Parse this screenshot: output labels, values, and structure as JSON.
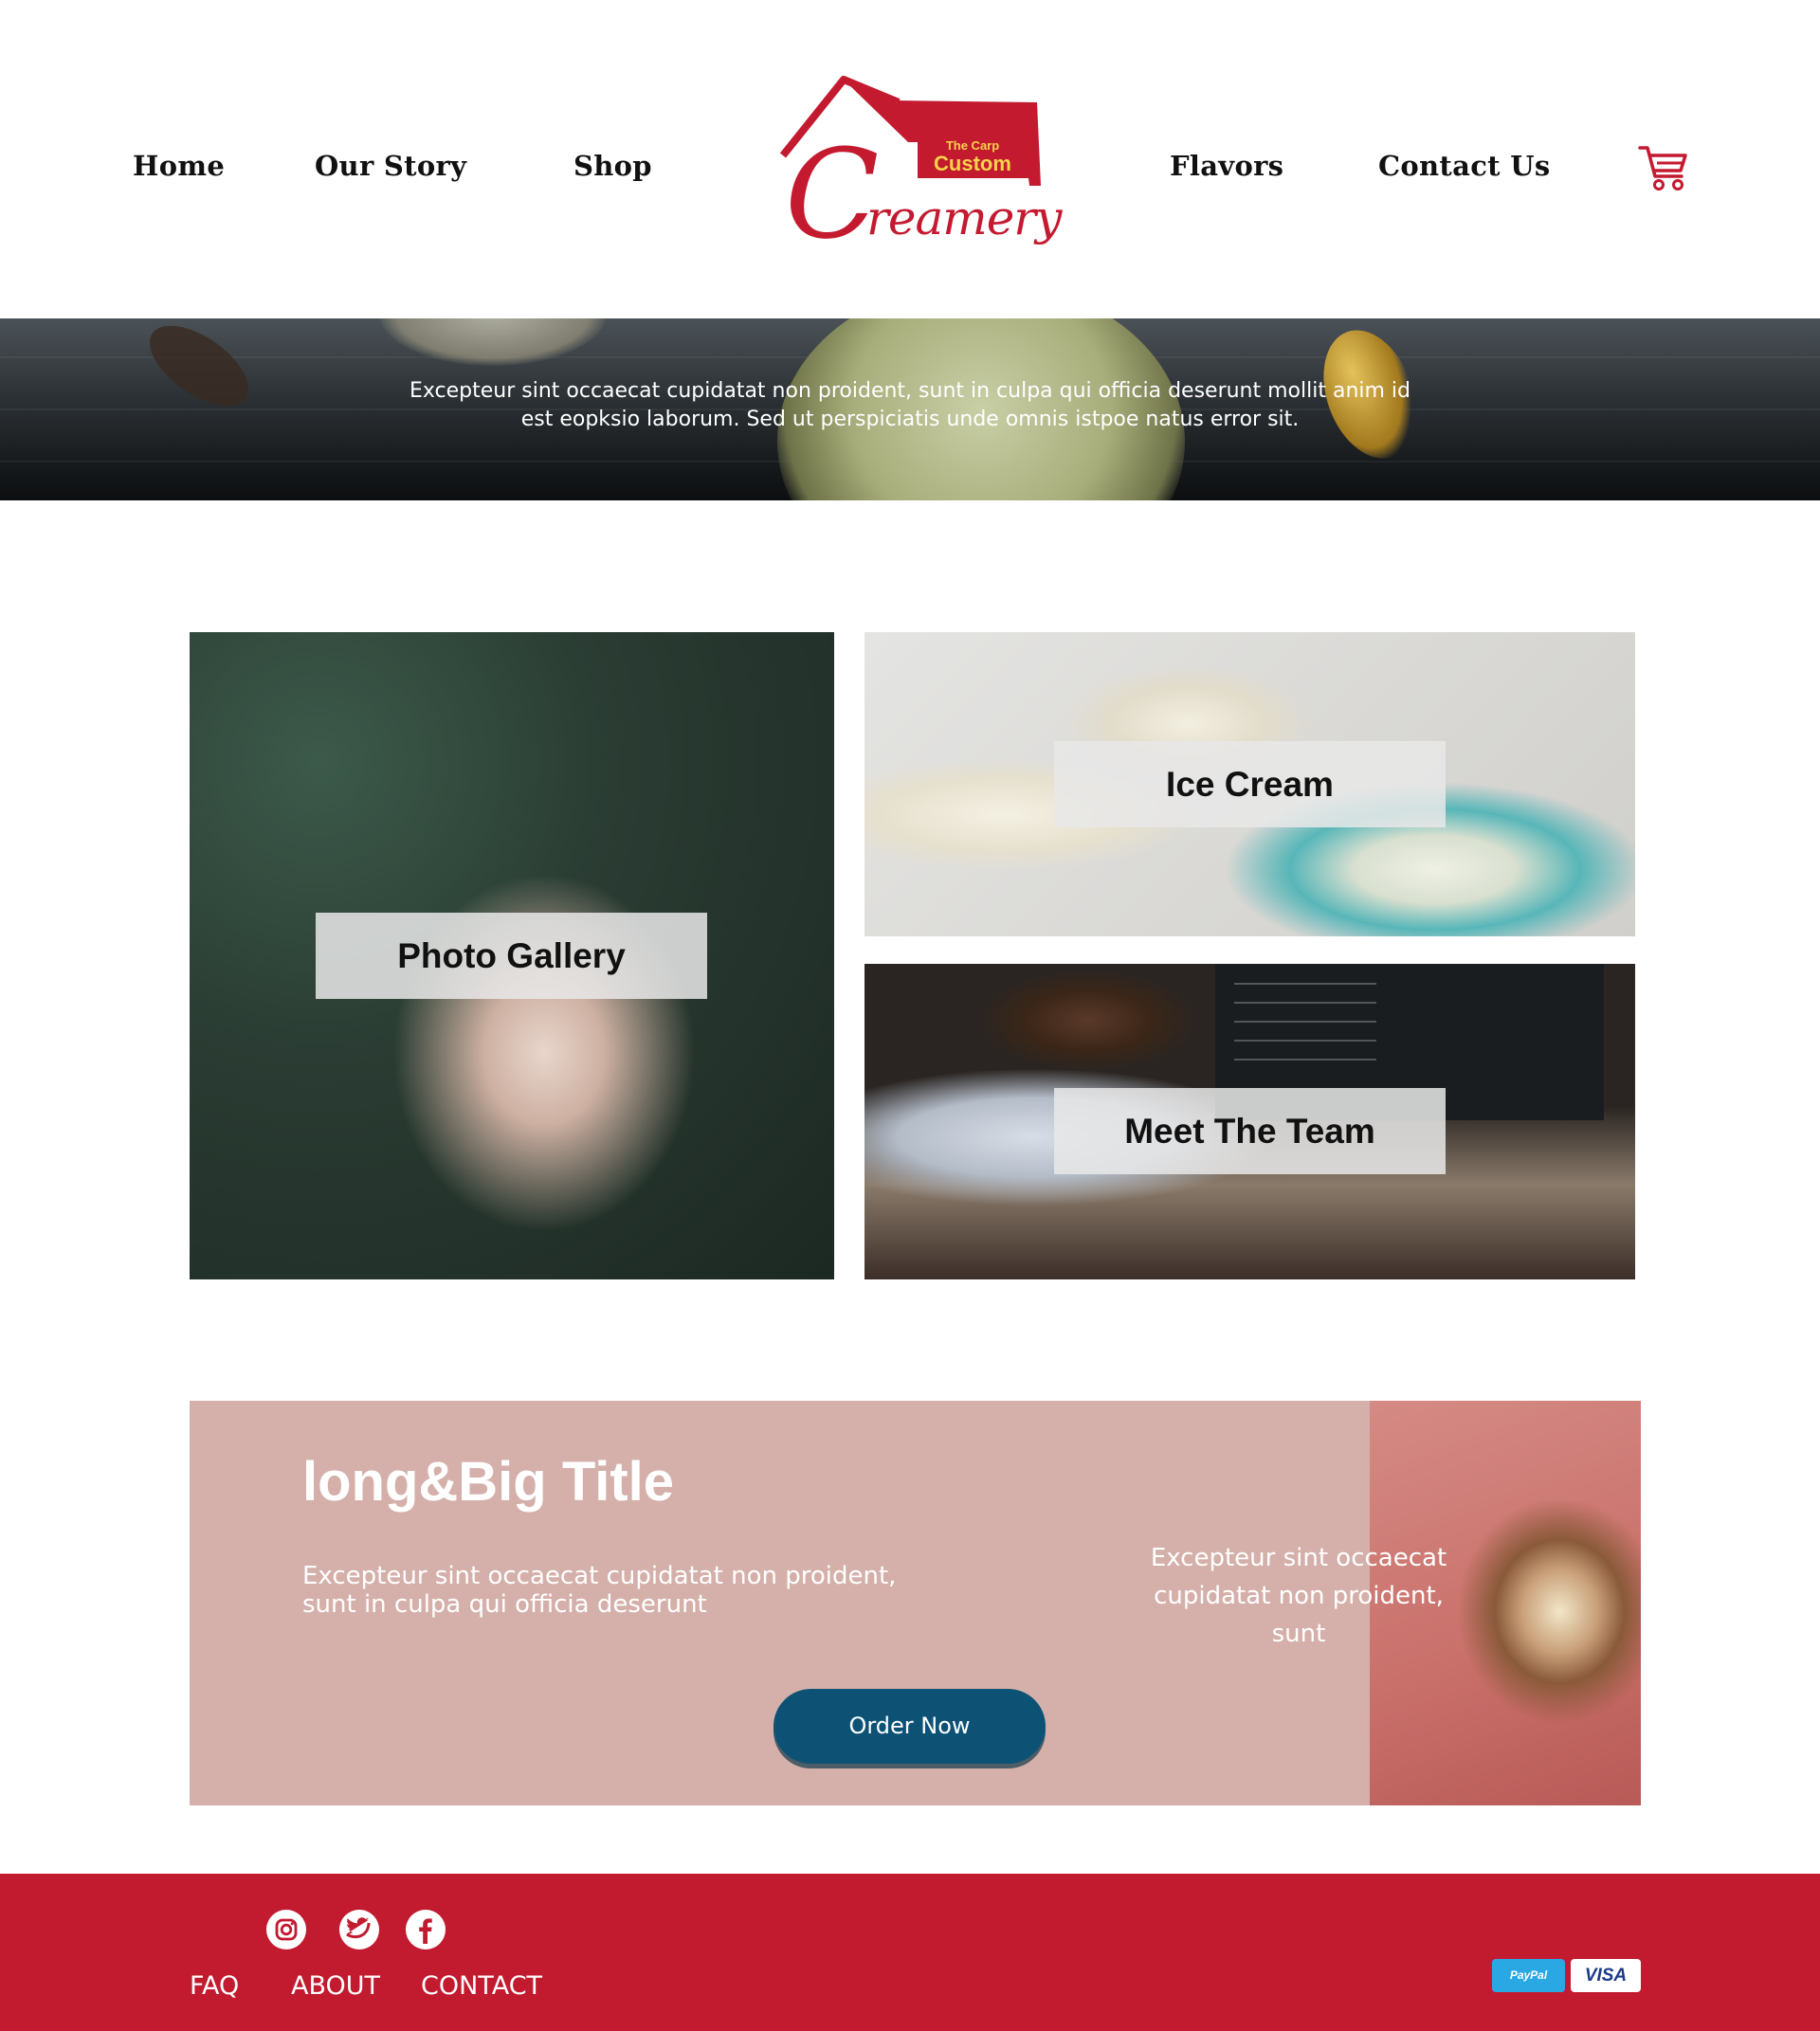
{
  "nav": {
    "home": "Home",
    "our_story": "Our Story",
    "shop": "Shop",
    "flavors": "Flavors",
    "contact_us": "Contact Us"
  },
  "logo": {
    "small": "The Carp",
    "custom": "Custom",
    "initial": "C",
    "word": "reamery"
  },
  "hero": {
    "text": "Excepteur sint occaecat cupidatat non proident, sunt in culpa qui officia deserunt mollit anim id est eopksio laborum. Sed ut perspiciatis unde omnis istpoe natus error sit."
  },
  "tiles": {
    "gallery": "Photo Gallery",
    "ice_cream": "Ice Cream",
    "team": "Meet The Team"
  },
  "promo": {
    "title": "long&Big Title",
    "text": "Excepteur sint occaecat cupidatat non proident, sunt in culpa qui officia deserunt",
    "side_text": "Excepteur sint occaecat cupidatat non proident, sunt",
    "button": "Order Now"
  },
  "footer": {
    "links": {
      "faq": "FAQ",
      "about": "ABOUT",
      "contact": "CONTACT"
    },
    "social": [
      "instagram-icon",
      "twitter-icon",
      "facebook-icon"
    ],
    "payments": {
      "paypal": "PayPal",
      "visa": "VISA"
    }
  },
  "colors": {
    "brand_red": "#c21a2f",
    "logo_yellow": "#f6d34a",
    "promo_bg": "#d5b0aa",
    "button_blue": "#0d5275"
  }
}
